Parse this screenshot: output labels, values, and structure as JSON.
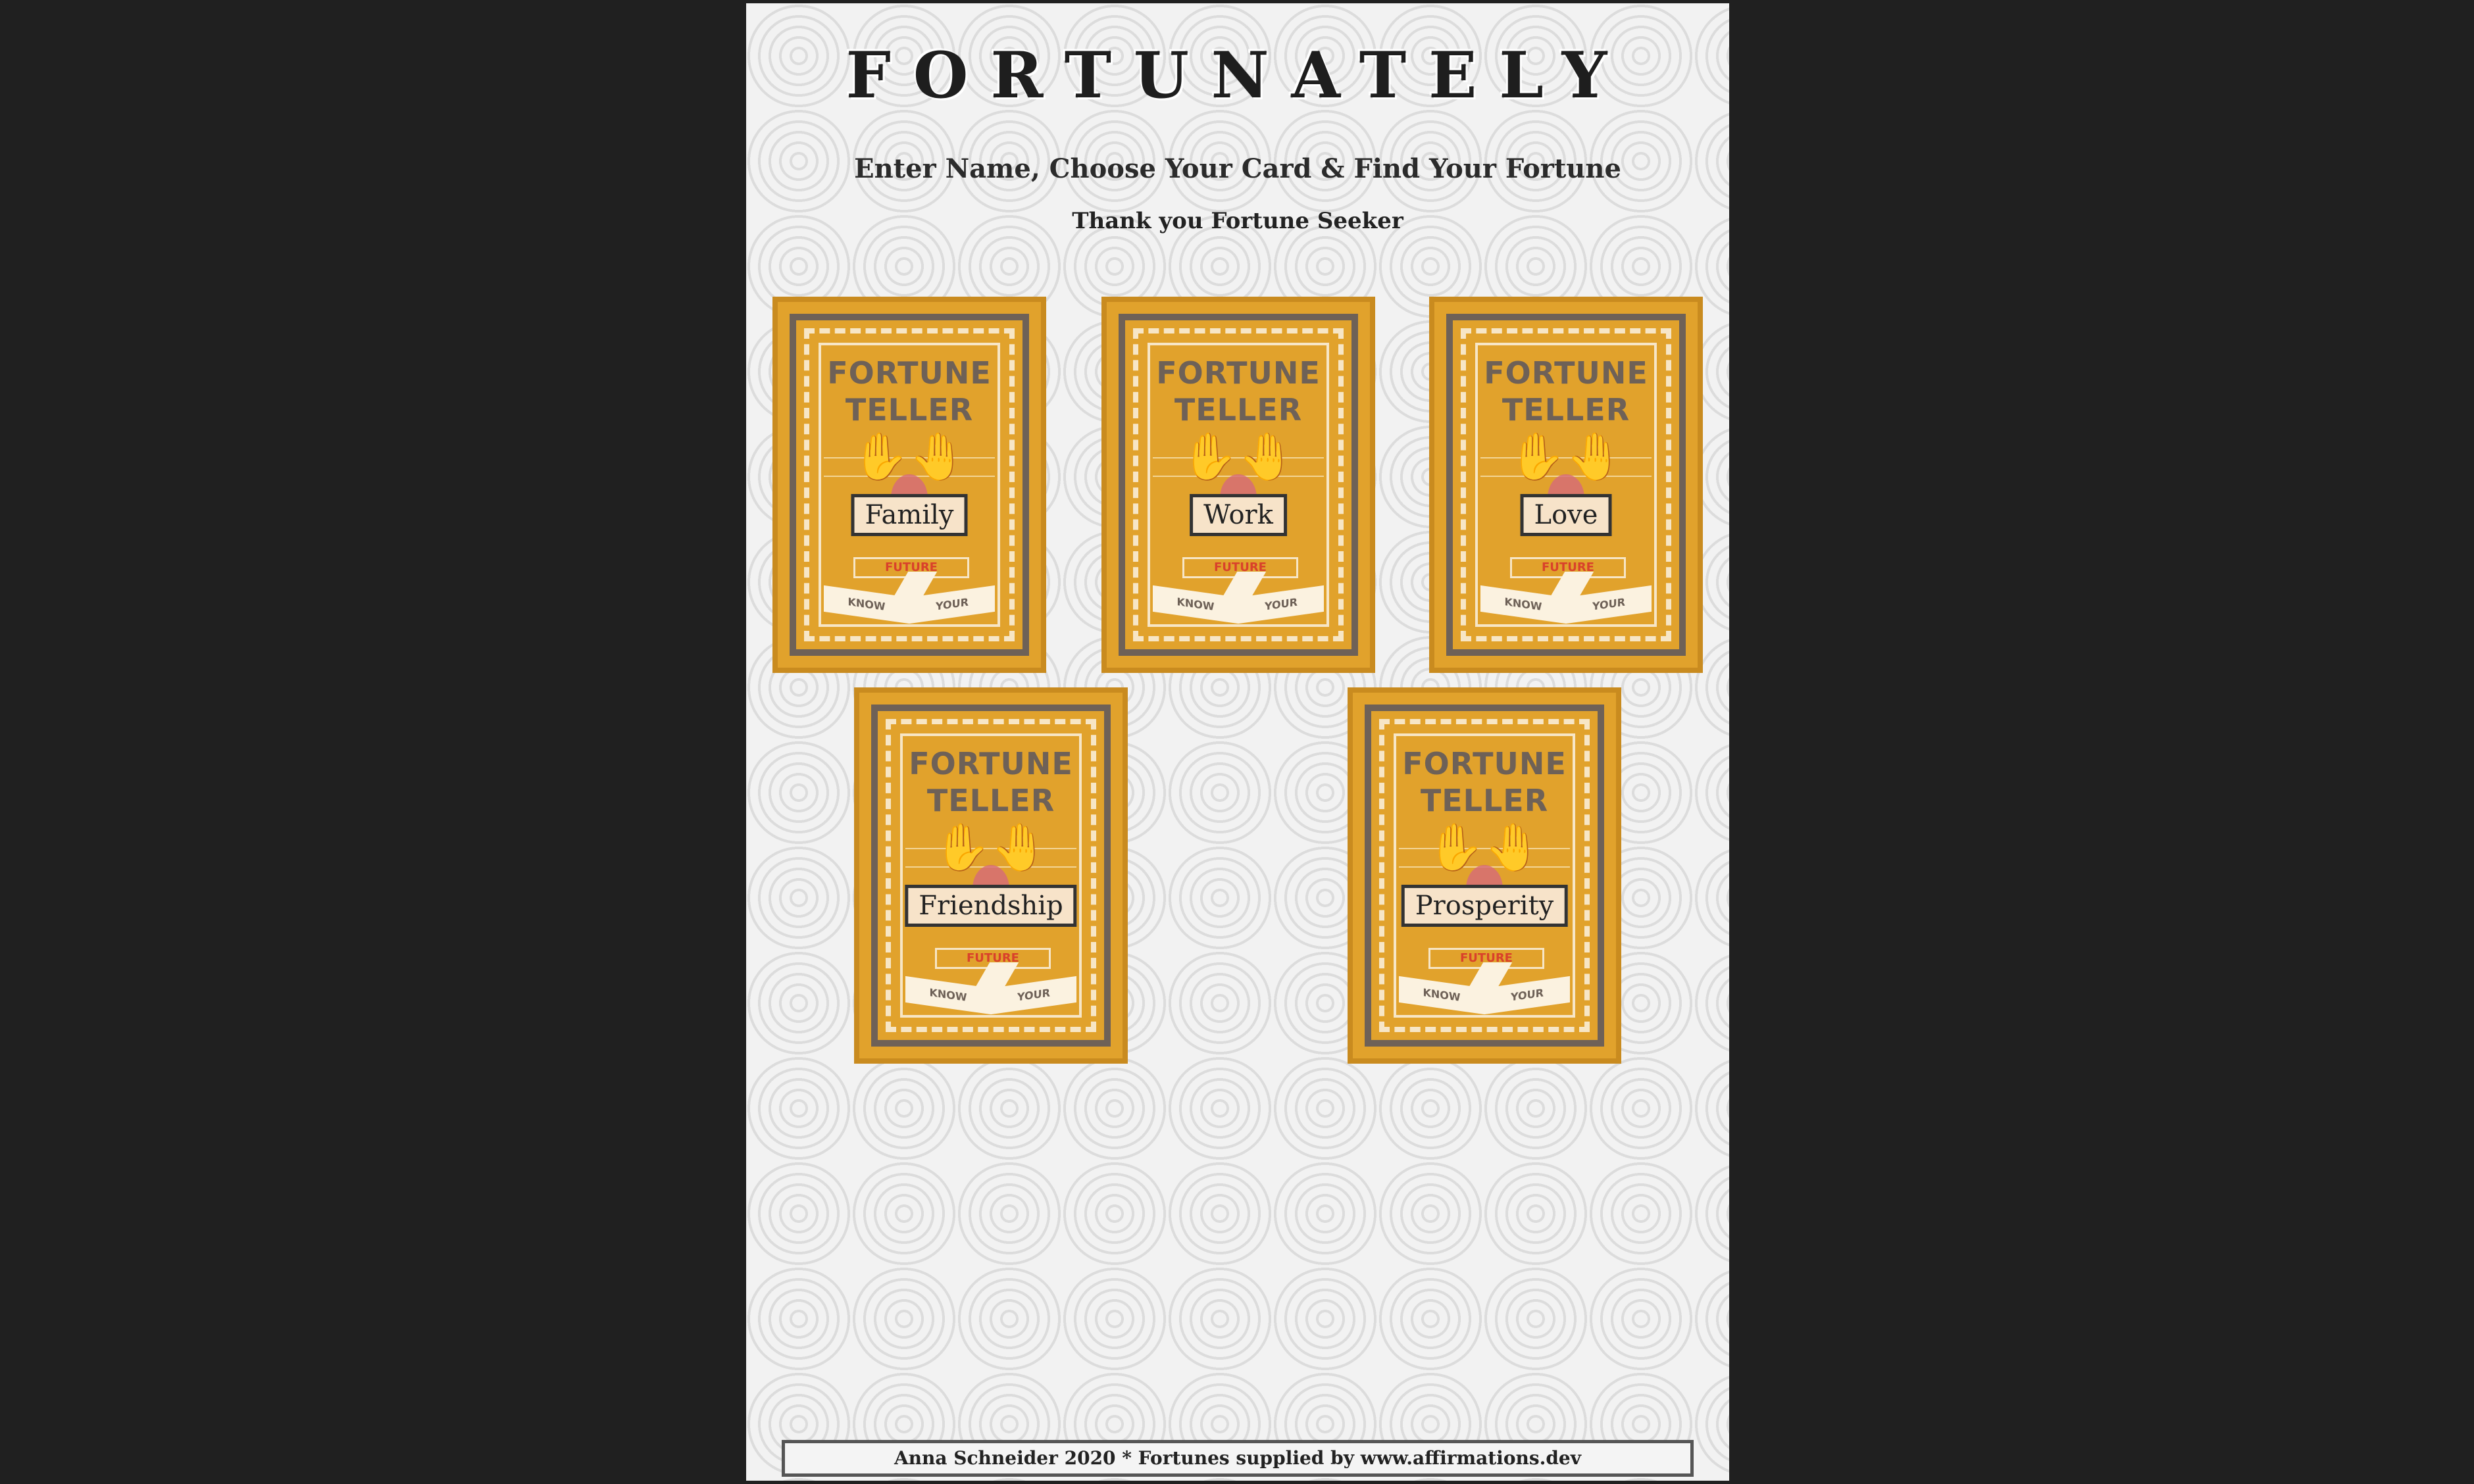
{
  "header": {
    "title": "FORTUNATELY",
    "subtitle": "Enter Name, Choose Your Card & Find Your Fortune",
    "thanks": "Thank you Fortune Seeker"
  },
  "card_common": {
    "title_line1": "FORTUNE",
    "title_line2": "TELLER",
    "future": "FUTURE",
    "know": "KNOW",
    "your": "YOUR"
  },
  "cards": [
    {
      "label": "Family"
    },
    {
      "label": "Work"
    },
    {
      "label": "Love"
    },
    {
      "label": "Friendship"
    },
    {
      "label": "Prosperity"
    }
  ],
  "footer": {
    "text": "Anna Schneider 2020 * Fortunes supplied by www.affirmations.dev"
  },
  "colors": {
    "card": "#e1a22c",
    "frame": "#6e6157",
    "background": "#202020"
  },
  "icons": {
    "hands": "palm-hands-icon"
  }
}
